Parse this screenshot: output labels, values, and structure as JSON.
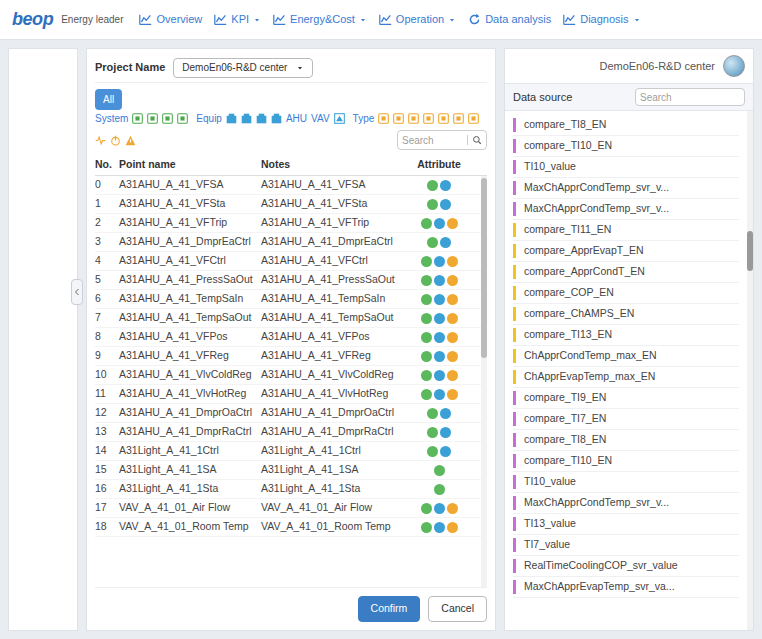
{
  "nav": {
    "logo": "beop",
    "subtitle": "Energy leader",
    "items": [
      {
        "label": "Overview",
        "dropdown": false
      },
      {
        "label": "KPI",
        "dropdown": true
      },
      {
        "label": "Energy&Cost",
        "dropdown": true
      },
      {
        "label": "Operation",
        "dropdown": true
      },
      {
        "label": "Data analysis",
        "dropdown": false
      },
      {
        "label": "Diagnosis",
        "dropdown": true
      }
    ]
  },
  "project": {
    "label": "Project Name",
    "value": "DemoEn06-R&D center"
  },
  "filter": {
    "all": {
      "label": "All",
      "selected": true
    },
    "system_label": "System",
    "equip_label": "Equip",
    "equip_texts": [
      "AHU",
      "VAV"
    ],
    "type_label": "Type",
    "search_placeholder": "Search"
  },
  "table": {
    "columns": [
      "No.",
      "Point name",
      "Notes",
      "Attribute"
    ],
    "rows": [
      {
        "no": "0",
        "point": "A31AHU_A_41_VFSA",
        "notes": "A31AHU_A_41_VFSA",
        "attributes": [
          {
            "color": "#5cb85c"
          },
          {
            "color": "#3aa0d6"
          }
        ]
      },
      {
        "no": "1",
        "point": "A31AHU_A_41_VFSta",
        "notes": "A31AHU_A_41_VFSta",
        "attributes": [
          {
            "color": "#5cb85c"
          },
          {
            "color": "#3aa0d6"
          }
        ]
      },
      {
        "no": "2",
        "point": "A31AHU_A_41_VFTrip",
        "notes": "A31AHU_A_41_VFTrip",
        "attributes": [
          {
            "color": "#5cb85c"
          },
          {
            "color": "#3aa0d6"
          },
          {
            "color": "#f0a830"
          }
        ]
      },
      {
        "no": "3",
        "point": "A31AHU_A_41_DmprEaCtrl",
        "notes": "A31AHU_A_41_DmprEaCtrl",
        "attributes": [
          {
            "color": "#5cb85c"
          },
          {
            "color": "#3aa0d6"
          }
        ]
      },
      {
        "no": "4",
        "point": "A31AHU_A_41_VFCtrl",
        "notes": "A31AHU_A_41_VFCtrl",
        "attributes": [
          {
            "color": "#5cb85c"
          },
          {
            "color": "#3aa0d6"
          },
          {
            "color": "#f0a830"
          }
        ]
      },
      {
        "no": "5",
        "point": "A31AHU_A_41_PressSaOut",
        "notes": "A31AHU_A_41_PressSaOut",
        "attributes": [
          {
            "color": "#5cb85c"
          },
          {
            "color": "#3aa0d6"
          },
          {
            "color": "#f0a830"
          }
        ]
      },
      {
        "no": "6",
        "point": "A31AHU_A_41_TempSaIn",
        "notes": "A31AHU_A_41_TempSaIn",
        "attributes": [
          {
            "color": "#5cb85c"
          },
          {
            "color": "#3aa0d6"
          },
          {
            "color": "#f0a830"
          }
        ]
      },
      {
        "no": "7",
        "point": "A31AHU_A_41_TempSaOut",
        "notes": "A31AHU_A_41_TempSaOut",
        "attributes": [
          {
            "color": "#5cb85c"
          },
          {
            "color": "#3aa0d6"
          },
          {
            "color": "#f0a830"
          }
        ]
      },
      {
        "no": "8",
        "point": "A31AHU_A_41_VFPos",
        "notes": "A31AHU_A_41_VFPos",
        "attributes": [
          {
            "color": "#5cb85c"
          },
          {
            "color": "#3aa0d6"
          },
          {
            "color": "#f0a830"
          }
        ]
      },
      {
        "no": "9",
        "point": "A31AHU_A_41_VFReg",
        "notes": "A31AHU_A_41_VFReg",
        "attributes": [
          {
            "color": "#5cb85c"
          },
          {
            "color": "#3aa0d6"
          },
          {
            "color": "#f0a830"
          }
        ]
      },
      {
        "no": "10",
        "point": "A31AHU_A_41_VlvColdReg",
        "notes": "A31AHU_A_41_VlvColdReg",
        "attributes": [
          {
            "color": "#5cb85c"
          },
          {
            "color": "#3aa0d6"
          },
          {
            "color": "#f0a830"
          }
        ]
      },
      {
        "no": "11",
        "point": "A31AHU_A_41_VlvHotReg",
        "notes": "A31AHU_A_41_VlvHotReg",
        "attributes": [
          {
            "color": "#5cb85c"
          },
          {
            "color": "#3aa0d6"
          },
          {
            "color": "#f0a830"
          }
        ]
      },
      {
        "no": "12",
        "point": "A31AHU_A_41_DmprOaCtrl",
        "notes": "A31AHU_A_41_DmprOaCtrl",
        "attributes": [
          {
            "color": "#5cb85c"
          },
          {
            "color": "#3aa0d6"
          }
        ]
      },
      {
        "no": "13",
        "point": "A31AHU_A_41_DmprRaCtrl",
        "notes": "A31AHU_A_41_DmprRaCtrl",
        "attributes": [
          {
            "color": "#5cb85c"
          },
          {
            "color": "#3aa0d6"
          }
        ]
      },
      {
        "no": "14",
        "point": "A31Light_A_41_1Ctrl",
        "notes": "A31Light_A_41_1Ctrl",
        "attributes": [
          {
            "color": "#5cb85c"
          },
          {
            "color": "#3aa0d6"
          }
        ]
      },
      {
        "no": "15",
        "point": "A31Light_A_41_1SA",
        "notes": "A31Light_A_41_1SA",
        "attributes": [
          {
            "color": "#5cb85c"
          }
        ]
      },
      {
        "no": "16",
        "point": "A31Light_A_41_1Sta",
        "notes": "A31Light_A_41_1Sta",
        "attributes": [
          {
            "color": "#5cb85c"
          }
        ]
      },
      {
        "no": "17",
        "point": "VAV_A_41_01_Air Flow",
        "notes": "VAV_A_41_01_Air Flow",
        "attributes": [
          {
            "color": "#5cb85c"
          },
          {
            "color": "#3aa0d6"
          },
          {
            "color": "#f0a830"
          }
        ]
      },
      {
        "no": "18",
        "point": "VAV_A_41_01_Room Temp",
        "notes": "VAV_A_41_01_Room Temp",
        "attributes": [
          {
            "color": "#5cb85c"
          },
          {
            "color": "#3aa0d6"
          },
          {
            "color": "#f0a830"
          }
        ]
      }
    ]
  },
  "buttons": [
    {
      "label": "Confirm",
      "primary": true
    },
    {
      "label": "Cancel",
      "primary": false
    }
  ],
  "datasource": {
    "project": "DemoEn06-R&D center",
    "title": "Data source",
    "search_placeholder": "Search",
    "items": [
      {
        "label": "compare_TI8_EN",
        "color": "#c86dd7"
      },
      {
        "label": "compare_TI10_EN",
        "color": "#c86dd7"
      },
      {
        "label": "TI10_value",
        "color": "#c86dd7"
      },
      {
        "label": "MaxChApprCondTemp_svr_v...",
        "color": "#c86dd7"
      },
      {
        "label": "MaxChApprCondTemp_svr_v...",
        "color": "#c86dd7"
      },
      {
        "label": "compare_TI11_EN",
        "color": "#f0c419"
      },
      {
        "label": "compare_ApprEvapT_EN",
        "color": "#f0c419"
      },
      {
        "label": "compare_ApprCondT_EN",
        "color": "#f0c419"
      },
      {
        "label": "compare_COP_EN",
        "color": "#f0c419"
      },
      {
        "label": "compare_ChAMPS_EN",
        "color": "#f0c419"
      },
      {
        "label": "compare_TI13_EN",
        "color": "#f0c419"
      },
      {
        "label": "ChApprCondTemp_max_EN",
        "color": "#f0c419"
      },
      {
        "label": "ChApprEvapTemp_max_EN",
        "color": "#f0c419"
      },
      {
        "label": "compare_TI9_EN",
        "color": "#c86dd7"
      },
      {
        "label": "compare_TI7_EN",
        "color": "#c86dd7"
      },
      {
        "label": "compare_TI8_EN",
        "color": "#c86dd7"
      },
      {
        "label": "compare_TI10_EN",
        "color": "#c86dd7"
      },
      {
        "label": "TI10_value",
        "color": "#c86dd7"
      },
      {
        "label": "MaxChApprCondTemp_svr_v...",
        "color": "#c86dd7"
      },
      {
        "label": "TI13_value",
        "color": "#c86dd7"
      },
      {
        "label": "TI7_value",
        "color": "#c86dd7"
      },
      {
        "label": "RealTimeCoolingCOP_svr_value",
        "color": "#c86dd7"
      },
      {
        "label": "MaxChApprEvapTemp_svr_va...",
        "color": "#c86dd7"
      }
    ]
  }
}
